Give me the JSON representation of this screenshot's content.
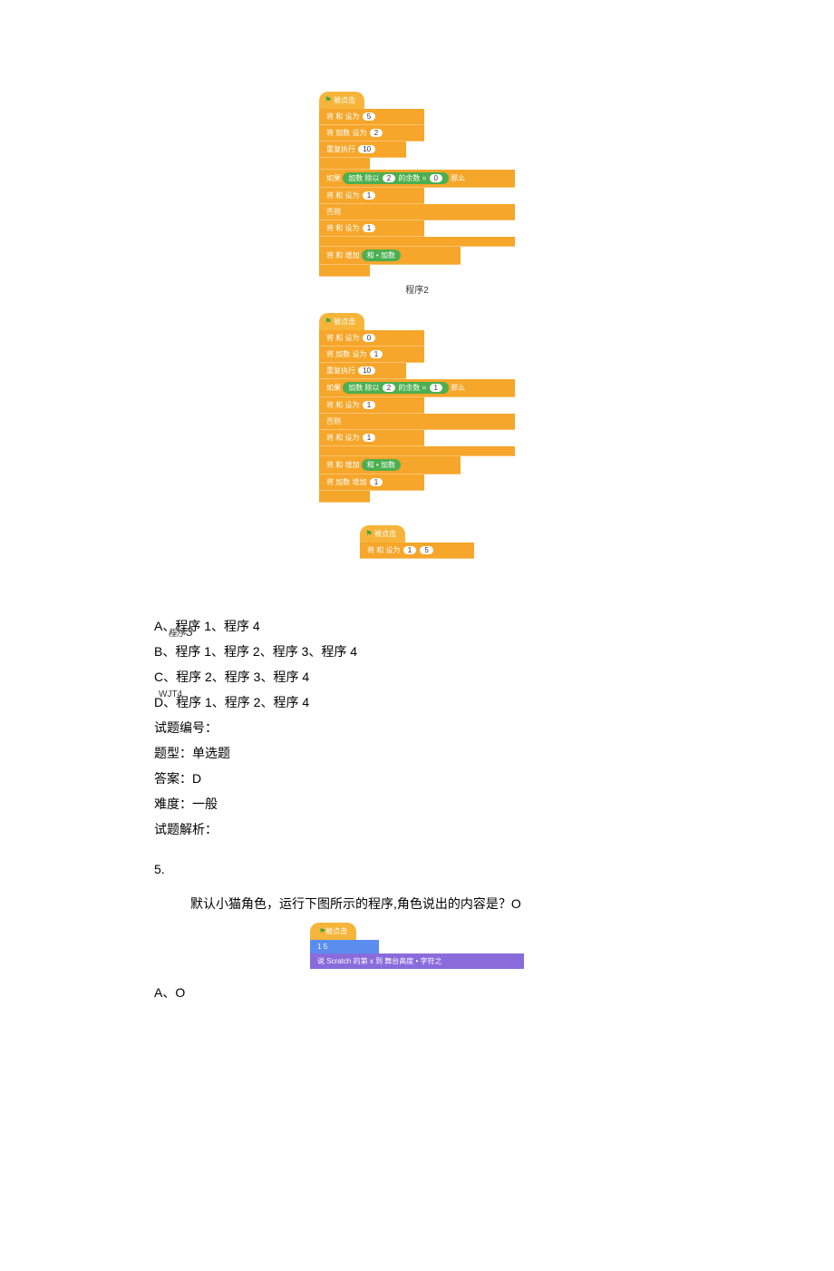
{
  "program2": {
    "hat": "被点击",
    "b1_pre": "将",
    "b1_var": "和",
    "b1_set": "设为",
    "b1_val": "5",
    "b2_pre": "将",
    "b2_var": "加数",
    "b2_set": "设为",
    "b2_val": "2",
    "b3_pre": "重复执行",
    "b3_val": "10",
    "b4_pre": "如果",
    "b4_g1": "加数",
    "b4_g2": "除以",
    "b4_g3": "2",
    "b4_g4": "的余数",
    "b4_g5": "0",
    "b4_post": "那么",
    "b5_pre": "将",
    "b5_var": "和",
    "b5_set": "设为",
    "b5_val": "1",
    "b6": "否则",
    "b7_pre": "将",
    "b7_var": "和",
    "b7_set": "设为",
    "b7_val": "1",
    "b8_pre": "将",
    "b8_var": "和",
    "b8_set": "增加",
    "b8_g1": "和",
    "b8_g2": "加数",
    "caption": "程序2"
  },
  "program3": {
    "prefix": "程序",
    "num": "3",
    "hat": "被点击",
    "b1_pre": "将",
    "b1_var": "和",
    "b1_set": "设为",
    "b1_val": "0",
    "b2_pre": "将",
    "b2_var": "加数",
    "b2_set": "设为",
    "b2_val": "1",
    "b3_pre": "重复执行",
    "b3_val": "10",
    "b4_pre": "如果",
    "b4_g1": "加数",
    "b4_g2": "除以",
    "b4_g3": "2",
    "b4_g4": "的余数",
    "b4_g5": "1",
    "b4_post": "那么",
    "b5_pre": "将",
    "b5_var": "和",
    "b5_set": "设为",
    "b5_val": "1",
    "b6": "否则",
    "b7_pre": "将",
    "b7_var": "和",
    "b7_set": "设为",
    "b7_val": "1",
    "b8_pre": "将",
    "b8_var": "和",
    "b8_set": "增加",
    "b8_g1": "和",
    "b8_g2": "加数",
    "b9_pre": "将",
    "b9_var": "加数",
    "b9_set": "增加",
    "b9_val": "1"
  },
  "program4": {
    "left_label": "WJT4",
    "hat": "被点击",
    "b1_pre": "将",
    "b1_var": "和",
    "b1_set": "设为",
    "b1_g1": "1",
    "b1_g2": "5"
  },
  "options": {
    "A": "A、程序 1、程序 4",
    "B": "B、程序 1、程序 2、程序 3、程序 4",
    "C": "C、程序 2、程序 3、程序 4",
    "D": "D、程序 1、程序 2、程序 4"
  },
  "meta": {
    "id_label": "试题编号：",
    "type_label": "题型：单选题",
    "answer_label": "答案：D",
    "difficulty_label": "难度：一般",
    "explain_label": "试题解析："
  },
  "q5": {
    "num": "5.",
    "prompt": "默认小猫角色，运行下图所示的程序,角色说出的内容是？O",
    "hat": "被点击",
    "blue_l": "1",
    "blue_op": "",
    "blue_r": "5",
    "purple_pre": "说",
    "purple_word": "Scratch",
    "purple_mid": "的第",
    "purple_x": "x",
    "purple_to": "到",
    "purple_end": "舞台高度",
    "purple_suffix": "字符之",
    "optA": "A、O"
  }
}
